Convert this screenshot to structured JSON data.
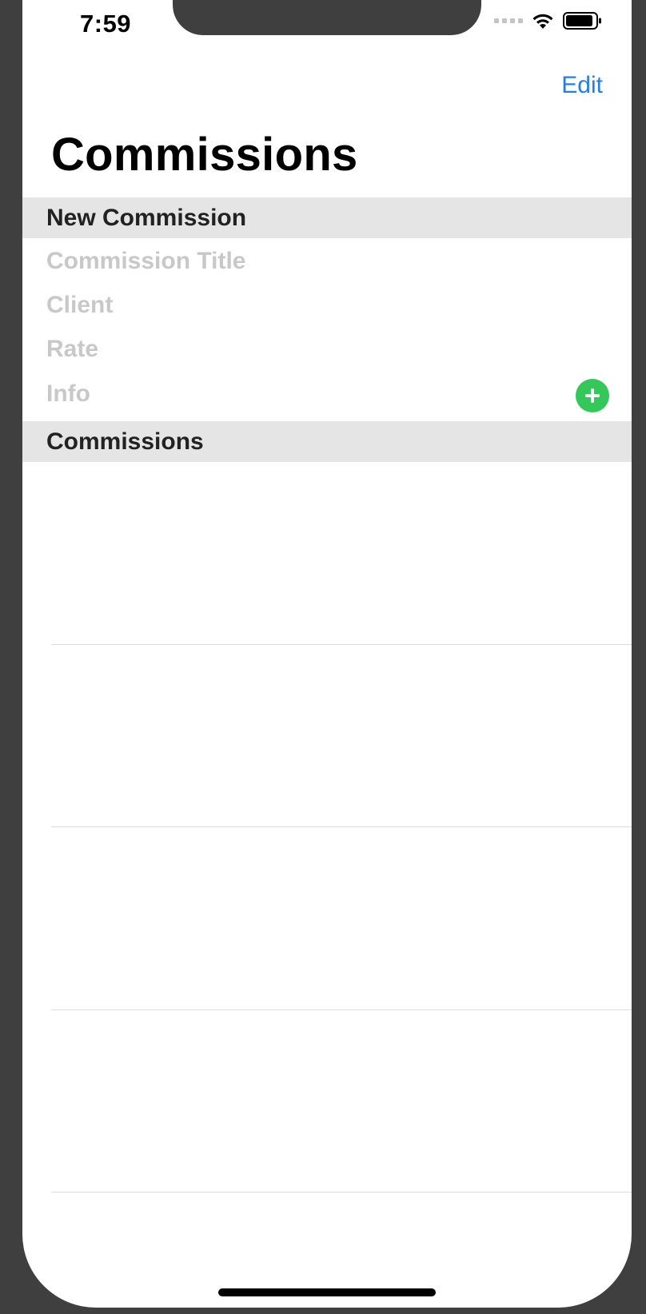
{
  "status_bar": {
    "time": "7:59"
  },
  "nav": {
    "edit_label": "Edit",
    "title": "Commissions"
  },
  "new_commission_section": {
    "header": "New Commission",
    "fields": {
      "title_placeholder": "Commission Title",
      "client_placeholder": "Client",
      "rate_placeholder": "Rate",
      "info_placeholder": "Info"
    },
    "add_button_icon": "plus-circle-icon"
  },
  "commissions_section": {
    "header": "Commissions",
    "rows": [
      {
        "label": ""
      },
      {
        "label": ""
      },
      {
        "label": ""
      },
      {
        "label": ""
      }
    ]
  },
  "colors": {
    "accent": "#1d7ff0",
    "add_button": "#34c759",
    "section_header_bg": "#e5e5e5",
    "placeholder_text": "#c8c8c8"
  }
}
